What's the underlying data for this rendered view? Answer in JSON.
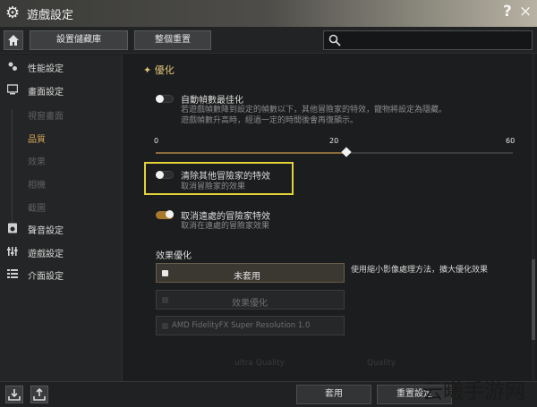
{
  "window": {
    "title": "遊戲設定",
    "help_label": "?",
    "close_label": "×"
  },
  "toolbar": {
    "save_preset_label": "設置儲藏庫",
    "reset_all_label": "整個重置",
    "search_placeholder": ""
  },
  "sidebar": {
    "items": [
      {
        "label": "性能設定",
        "icon": "sliders-icon"
      },
      {
        "label": "畫面設定",
        "icon": "monitor-icon"
      },
      {
        "label": "聲音設定",
        "icon": "speaker-icon"
      },
      {
        "label": "遊戲設定",
        "icon": "equalizer-icon"
      },
      {
        "label": "介面設定",
        "icon": "list-icon"
      }
    ],
    "subitems": [
      {
        "label": "視窗畫面",
        "active": false
      },
      {
        "label": "品質",
        "active": true
      },
      {
        "label": "效果",
        "active": false
      },
      {
        "label": "相機",
        "active": false
      },
      {
        "label": "截圖",
        "active": false
      }
    ]
  },
  "main": {
    "section_title": "優化",
    "auto_fps": {
      "label": "自動幀數最佳化",
      "desc1": "若遊戲幀數降到設定的幀數以下，其他冒險家的特效，寵物將設定為隱藏。",
      "desc2": "遊戲幀數升高時，經過一定的時間後會再復顯示。",
      "enabled": false
    },
    "fps_slider": {
      "min_label": "0",
      "mid_label": "20",
      "max_label": "60",
      "value": 20
    },
    "hide_others_effects": {
      "label": "清除其他冒險家的特效",
      "desc": "取消冒險家的效果",
      "enabled": false
    },
    "hide_distant_effects": {
      "label": "取消遠處的冒險家特效",
      "desc": "取消在遠處的冒險家效果",
      "enabled": true
    },
    "effect_opt": {
      "title": "效果優化",
      "options": [
        {
          "label": "未套用",
          "selected": true
        },
        {
          "label": "效果優化",
          "selected": false
        },
        {
          "label": "AMD FidelityFX Super Resolution 1.0",
          "selected": false
        }
      ],
      "note": "使用縮小影像處理方法，擴大優化效果"
    },
    "faded": {
      "left": "ultra Quality",
      "right": "Quality"
    }
  },
  "footer": {
    "apply_label": "套用",
    "reset_label": "重置設定"
  },
  "watermark": {
    "text": "云曦手游网"
  },
  "colors": {
    "accent": "#d6a85a",
    "highlight": "#e3d33a",
    "toggle_on": "#a97a2e"
  }
}
